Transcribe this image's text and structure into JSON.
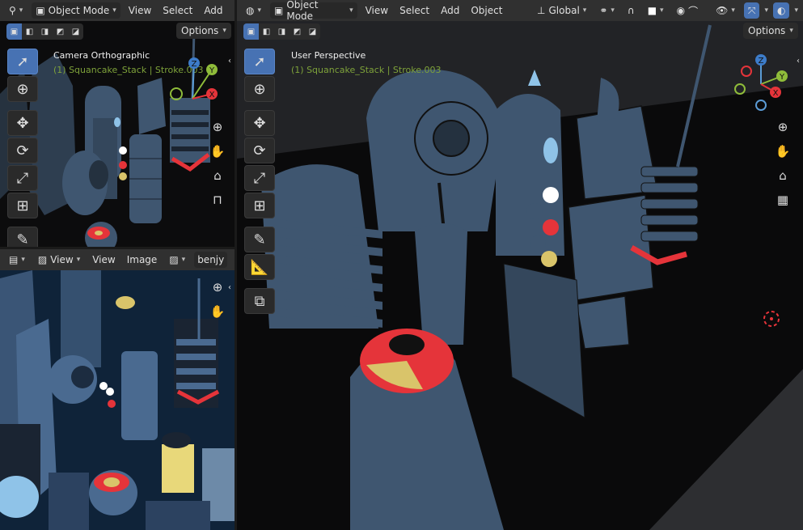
{
  "left_top": {
    "mode_label": "Object Mode",
    "menus": [
      "View",
      "Select",
      "Add"
    ],
    "options_label": "Options",
    "view_title": "Camera Orthographic",
    "view_subtitle": "(1) Squancake_Stack | Stroke.003"
  },
  "left_bottom": {
    "menus": [
      "View",
      "View",
      "Image"
    ],
    "image_name": "benjy"
  },
  "main": {
    "mode_label": "Object Mode",
    "menus": [
      "View",
      "Select",
      "Add",
      "Object"
    ],
    "transform_orientation": "Global",
    "options_label": "Options",
    "view_title": "User Perspective",
    "view_subtitle": "(1) Squancake_Stack | Stroke.003"
  },
  "gizmo_axes": [
    "X",
    "Y",
    "Z"
  ],
  "colors": {
    "accent": "#4772b3",
    "subtitle_green": "#7ea23a",
    "object_blue": "#3f5670",
    "highlight_red": "#e5343a",
    "highlight_yellow": "#d9c46a"
  }
}
